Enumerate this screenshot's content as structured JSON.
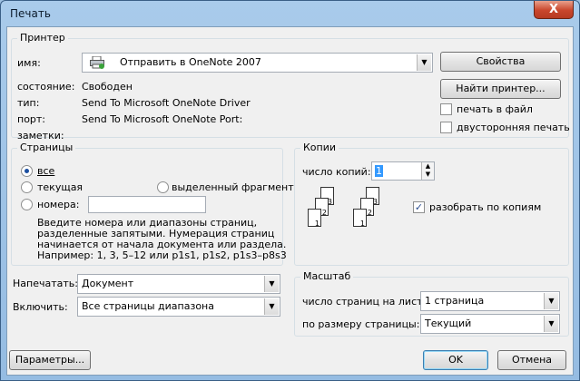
{
  "window": {
    "title": "Печать",
    "close_glyph": "X"
  },
  "printer": {
    "group_title": "Принтер",
    "name_label": "имя:",
    "name_value": "Отправить в OneNote 2007",
    "status_label": "состояние:",
    "status_value": "Свободен",
    "type_label": "тип:",
    "type_value": "Send To Microsoft OneNote Driver",
    "port_label": "порт:",
    "port_value": "Send To Microsoft OneNote Port:",
    "notes_label": "заметки:",
    "properties_button": "Свойства",
    "find_button": "Найти принтер...",
    "print_to_file": "печать в файл",
    "print_to_file_checked": false,
    "duplex": "двусторонняя печать",
    "duplex_checked": false
  },
  "pages": {
    "group_title": "Страницы",
    "all": "все",
    "current": "текущая",
    "selection": "выделенный фрагмент",
    "numbers": "номера:",
    "selected_option": "all",
    "help_lines": [
      "Введите номера или диапазоны страниц,",
      "разделенные запятыми. Нумерация страниц",
      "начинается от начала документа или раздела.",
      "Например: 1, 3, 5–12 или p1s1, p1s2, p1s3–p8s3"
    ]
  },
  "copies": {
    "group_title": "Копии",
    "count_label": "число копий:",
    "count_value": "1",
    "collate_label": "разобрать по копиям",
    "collate_checked": true,
    "page_numbers": [
      "1",
      "2",
      "3"
    ]
  },
  "print_what": {
    "label": "Напечатать:",
    "value": "Документ"
  },
  "include": {
    "label": "Включить:",
    "value": "Все страницы диапазона"
  },
  "zoom": {
    "group_title": "Масштаб",
    "pages_per_sheet_label": "число страниц на листе:",
    "pages_per_sheet_value": "1 страница",
    "scale_label": "по размеру страницы:",
    "scale_value": "Текущий"
  },
  "footer": {
    "options_button": "Параметры...",
    "ok_button": "OK",
    "cancel_button": "Отмена"
  }
}
